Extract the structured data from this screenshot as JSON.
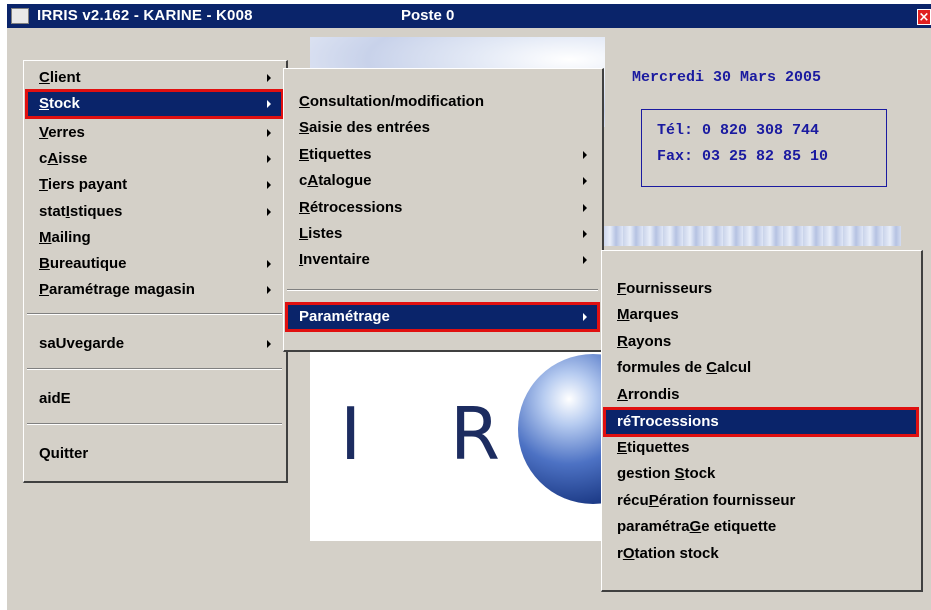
{
  "window": {
    "title": "IRRIS v2.162 - KARINE - K008",
    "poste": "Poste 0",
    "close_glyph": "×"
  },
  "background": {
    "date": "Mercredi 30 Mars 2005",
    "tel": "Tél: 0 820 308 744",
    "fax": "Fax: 03 25 82 85 10",
    "logo_letter_1": "I",
    "logo_letter_2": "R"
  },
  "main_menu": {
    "items": [
      {
        "pre": "",
        "key": "C",
        "post": "lient",
        "submenu": true
      },
      {
        "pre": "",
        "key": "S",
        "post": "tock",
        "submenu": true,
        "selected": true
      },
      {
        "pre": "",
        "key": "V",
        "post": "erres",
        "submenu": true
      },
      {
        "pre": "c",
        "key": "A",
        "post": "isse",
        "submenu": true
      },
      {
        "pre": "",
        "key": "T",
        "post": "iers payant",
        "submenu": true
      },
      {
        "pre": "stat",
        "key": "I",
        "post": "stiques",
        "submenu": true
      },
      {
        "pre": "",
        "key": "M",
        "post": "ailing",
        "submenu": false
      },
      {
        "pre": "",
        "key": "B",
        "post": "ureautique",
        "submenu": true
      },
      {
        "pre": "",
        "key": "P",
        "post": "aramétrage magasin",
        "submenu": true
      },
      {
        "pre": "saUvegarde",
        "key": "",
        "post": "",
        "submenu": true
      },
      {
        "pre": "aidE",
        "key": "",
        "post": "",
        "submenu": false
      },
      {
        "pre": "Quitter",
        "key": "",
        "post": "",
        "submenu": false
      }
    ]
  },
  "stock_menu": {
    "items": [
      {
        "pre": "",
        "key": "C",
        "post": "onsultation/modification",
        "submenu": false
      },
      {
        "pre": "",
        "key": "S",
        "post": "aisie des entrées",
        "submenu": false
      },
      {
        "pre": "",
        "key": "E",
        "post": "tiquettes",
        "submenu": true
      },
      {
        "pre": "c",
        "key": "A",
        "post": "talogue",
        "submenu": true
      },
      {
        "pre": "",
        "key": "R",
        "post": "étrocessions",
        "submenu": true
      },
      {
        "pre": "",
        "key": "L",
        "post": "istes",
        "submenu": true
      },
      {
        "pre": "",
        "key": "I",
        "post": "nventaire",
        "submenu": true
      },
      {
        "pre": "Paramétrage",
        "key": "",
        "post": "",
        "submenu": true,
        "selected": true
      }
    ]
  },
  "param_menu": {
    "items": [
      {
        "pre": "",
        "key": "F",
        "post": "ournisseurs"
      },
      {
        "pre": "",
        "key": "M",
        "post": "arques"
      },
      {
        "pre": "",
        "key": "R",
        "post": "ayons"
      },
      {
        "pre": "formules de ",
        "key": "C",
        "post": "alcul"
      },
      {
        "pre": "",
        "key": "A",
        "post": "rrondis"
      },
      {
        "pre": "réTrocessions",
        "key": "",
        "post": "",
        "selected": true
      },
      {
        "pre": "",
        "key": "E",
        "post": "tiquettes"
      },
      {
        "pre": "gestion ",
        "key": "S",
        "post": "tock"
      },
      {
        "pre": "récu",
        "key": "P",
        "post": "ération fournisseur"
      },
      {
        "pre": "paramétra",
        "key": "G",
        "post": "e etiquette"
      },
      {
        "pre": "r",
        "key": "O",
        "post": "tation stock"
      }
    ]
  }
}
